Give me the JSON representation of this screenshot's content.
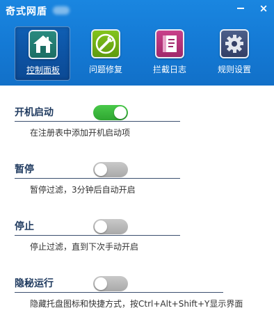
{
  "window": {
    "title": "奇式网盾",
    "minimize_label": "-",
    "close_label": "×"
  },
  "toolbar": {
    "items": [
      {
        "label": "控制面板",
        "icon": "home-icon",
        "active": true
      },
      {
        "label": "问题修复",
        "icon": "wrench-icon",
        "active": false
      },
      {
        "label": "拦截日志",
        "icon": "log-book-icon",
        "active": false
      },
      {
        "label": "规则设置",
        "icon": "gear-icon",
        "active": false
      }
    ]
  },
  "settings": [
    {
      "title": "开机启动",
      "description": "在注册表中添加开机启动项",
      "enabled": true
    },
    {
      "title": "暂停",
      "description": "暂停过滤，3分钟后自动开启",
      "enabled": false
    },
    {
      "title": "停止",
      "description": "停止过滤，直到下次手动开启",
      "enabled": false
    },
    {
      "title": "隐秘运行",
      "description": "隐藏托盘图标和快捷方式，按Ctrl+Alt+Shift+Y显示界面",
      "enabled": false
    }
  ],
  "colors": {
    "header": "#1479d4",
    "toggle_on": "#3cb73e",
    "toggle_off": "#b9b9b9",
    "title_text": "#1f3a5f"
  }
}
